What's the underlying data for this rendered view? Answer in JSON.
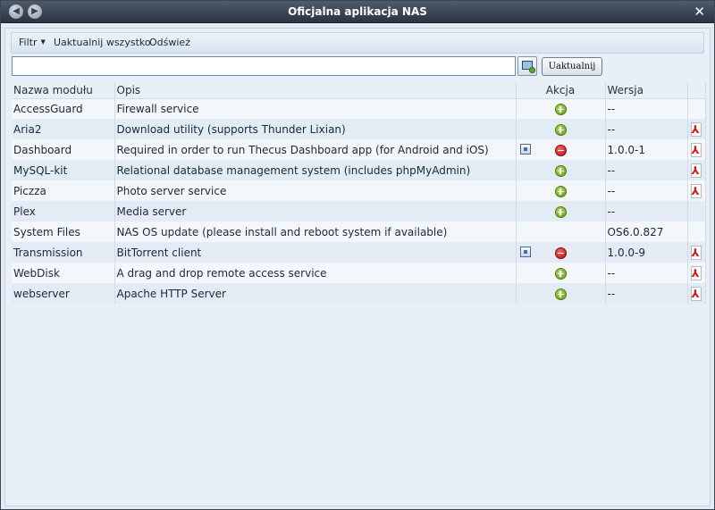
{
  "window": {
    "title": "Oficjalna aplikacja NAS",
    "back_glyph": "◀",
    "forward_glyph": "▶",
    "close_glyph": "✕"
  },
  "toolbar": {
    "filter_label": "Filtr",
    "update_all_label": "Uaktualnij wszystko",
    "refresh_label": "Odśwież"
  },
  "search": {
    "value": "",
    "placeholder": "",
    "update_button_label": "Uaktualnij"
  },
  "table": {
    "columns": [
      "Nazwa modułu",
      "Opis",
      "Akcja",
      "Wersja"
    ],
    "rows": [
      {
        "name": "AccessGuard",
        "description": "Firewall service",
        "action": "install",
        "version": "--",
        "pdf": false
      },
      {
        "name": "Aria2",
        "description": "Download utility (supports Thunder Lixian)",
        "action": "install",
        "version": "--",
        "pdf": true
      },
      {
        "name": "Dashboard",
        "description": "Required in order to run Thecus Dashboard app (for Android and iOS)",
        "action": "remove",
        "version": "1.0.0-1",
        "pdf": true
      },
      {
        "name": "MySQL-kit",
        "description": "Relational database management system (includes phpMyAdmin)",
        "action": "install",
        "version": "--",
        "pdf": true
      },
      {
        "name": "Piczza",
        "description": "Photo server service",
        "action": "install",
        "version": "--",
        "pdf": true
      },
      {
        "name": "Plex",
        "description": "Media server",
        "action": "install",
        "version": "--",
        "pdf": false
      },
      {
        "name": "System Files",
        "description": "NAS OS update (please install and reboot system if available)",
        "action": "none",
        "version": "OS6.0.827",
        "pdf": false
      },
      {
        "name": "Transmission",
        "description": "BitTorrent client",
        "action": "remove",
        "version": "1.0.0-9",
        "pdf": true
      },
      {
        "name": "WebDisk",
        "description": "A drag and drop remote access service",
        "action": "install",
        "version": "--",
        "pdf": true
      },
      {
        "name": "webserver",
        "description": "Apache HTTP Server",
        "action": "install",
        "version": "--",
        "pdf": true
      }
    ]
  },
  "colors": {
    "titlebar": "#2a3442",
    "row_light": "#f3f6fa",
    "row_dark": "#e3ebf4",
    "install_green": "#5d9a16",
    "remove_red": "#b00f0f",
    "pdf_red": "#d81212"
  },
  "icons": {
    "install": "plus-circle-icon",
    "remove": "minus-circle-icon",
    "open": "app-window-icon",
    "docs": "pdf-icon"
  }
}
